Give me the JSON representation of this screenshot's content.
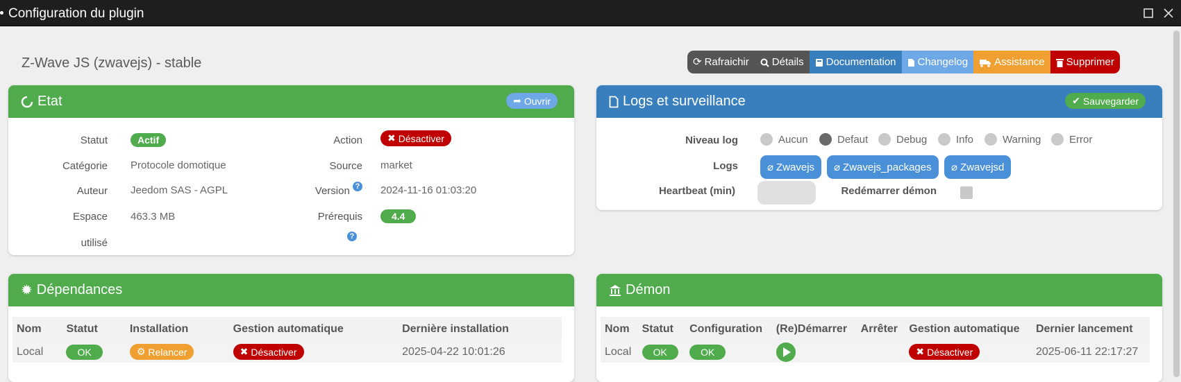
{
  "window": {
    "title": "Configuration du plugin"
  },
  "plugin": {
    "title": "Z-Wave JS (zwavejs) - stable"
  },
  "toolbar": {
    "refresh": "Rafraichir",
    "details": "Détails",
    "documentation": "Documentation",
    "changelog": "Changelog",
    "assistance": "Assistance",
    "delete": "Supprimer",
    "colors": {
      "refresh": "#555555",
      "details": "#555555",
      "documentation": "#3a7fbd",
      "changelog": "#6fa8e6",
      "assistance": "#f0a030",
      "delete": "#c00000"
    }
  },
  "etat": {
    "title": "Etat",
    "open_button": "Ouvrir",
    "statut_label": "Statut",
    "statut_value": "Actif",
    "action_label": "Action",
    "action_button": "Désactiver",
    "categorie_label": "Catégorie",
    "categorie_value": "Protocole domotique",
    "source_label": "Source",
    "source_value": "market",
    "auteur_label": "Auteur",
    "auteur_value": "Jeedom SAS - AGPL",
    "version_label": "Version",
    "version_value": "2024-11-16 01:03:20",
    "espace_label_1": "Espace",
    "espace_label_2": "utilisé",
    "espace_value": "463.3 MB",
    "prerequis_label": "Prérequis",
    "prerequis_value": "4.4"
  },
  "logs": {
    "title": "Logs et surveillance",
    "save_button": "Sauvegarder",
    "niveau_label": "Niveau log",
    "levels": [
      "Aucun",
      "Defaut",
      "Debug",
      "Info",
      "Warning",
      "Error"
    ],
    "selected_level": "Defaut",
    "logs_label": "Logs",
    "log_buttons": [
      "Zwavejs",
      "Zwavejs_packages",
      "Zwavejsd"
    ],
    "heartbeat_label": "Heartbeat (min)",
    "heartbeat_value": "",
    "restart_label": "Redémarrer démon"
  },
  "dependances": {
    "title": "Dépendances",
    "headers": [
      "Nom",
      "Statut",
      "Installation",
      "Gestion automatique",
      "Dernière installation"
    ],
    "row": {
      "nom": "Local",
      "statut": "OK",
      "installation": "Relancer",
      "gestion": "Désactiver",
      "derniere": "2025-04-22 10:01:26"
    }
  },
  "demon": {
    "title": "Démon",
    "headers": [
      "Nom",
      "Statut",
      "Configuration",
      "(Re)Démarrer",
      "Arrêter",
      "Gestion automatique",
      "Dernier lancement"
    ],
    "row": {
      "nom": "Local",
      "statut": "OK",
      "configuration": "OK",
      "gestion": "Désactiver",
      "dernier": "2025-06-11 22:17:27"
    }
  }
}
